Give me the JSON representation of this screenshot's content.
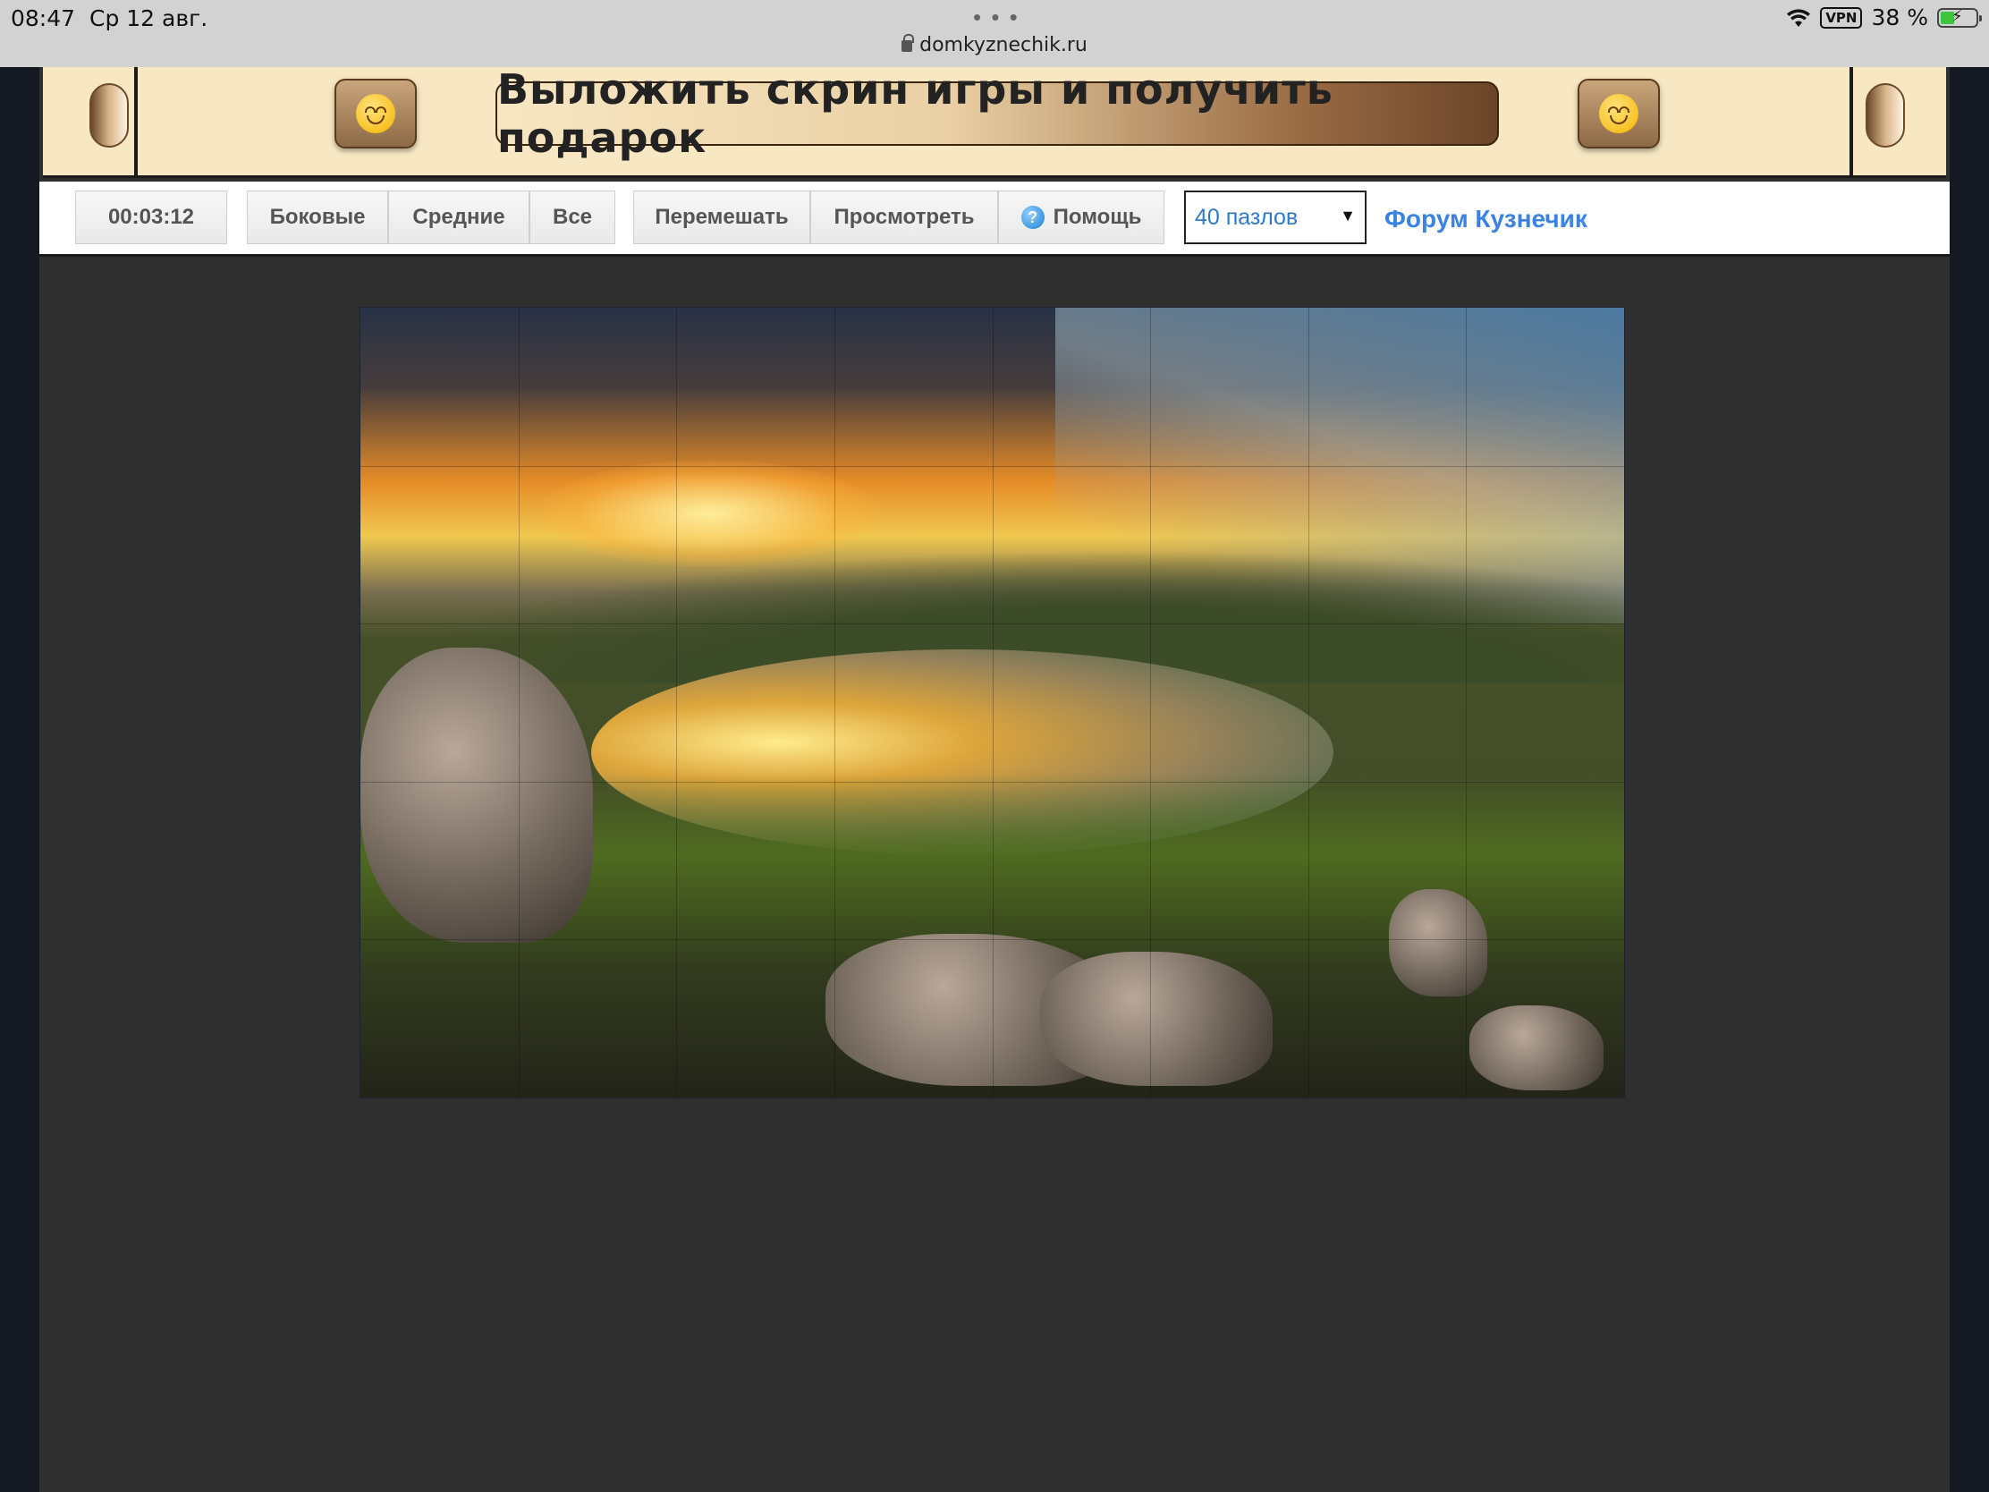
{
  "status_bar": {
    "time": "08:47",
    "date": "Ср 12 авг.",
    "url": "domkyznechik.ru",
    "vpn": "VPN",
    "battery": "38 %"
  },
  "banner": {
    "cta": "Выложить скрин игры и получить подарок"
  },
  "toolbar": {
    "timer": "00:03:12",
    "filter_buttons": [
      "Боковые",
      "Средние",
      "Все"
    ],
    "action_buttons": [
      "Перемешать",
      "Просмотреть"
    ],
    "help_label": "Помощь",
    "pieces_select": "40 пазлов",
    "forum_link": "Форум Кузнечик"
  },
  "puzzle": {
    "image_alt": "sunset lake landscape jigsaw",
    "grid": {
      "cols": 8,
      "rows": 5
    }
  },
  "colors": {
    "link": "#3b82e6",
    "select_text": "#2b79d6",
    "banner_bg": "#f7e7c2",
    "page_bg": "#2f2f2f"
  }
}
